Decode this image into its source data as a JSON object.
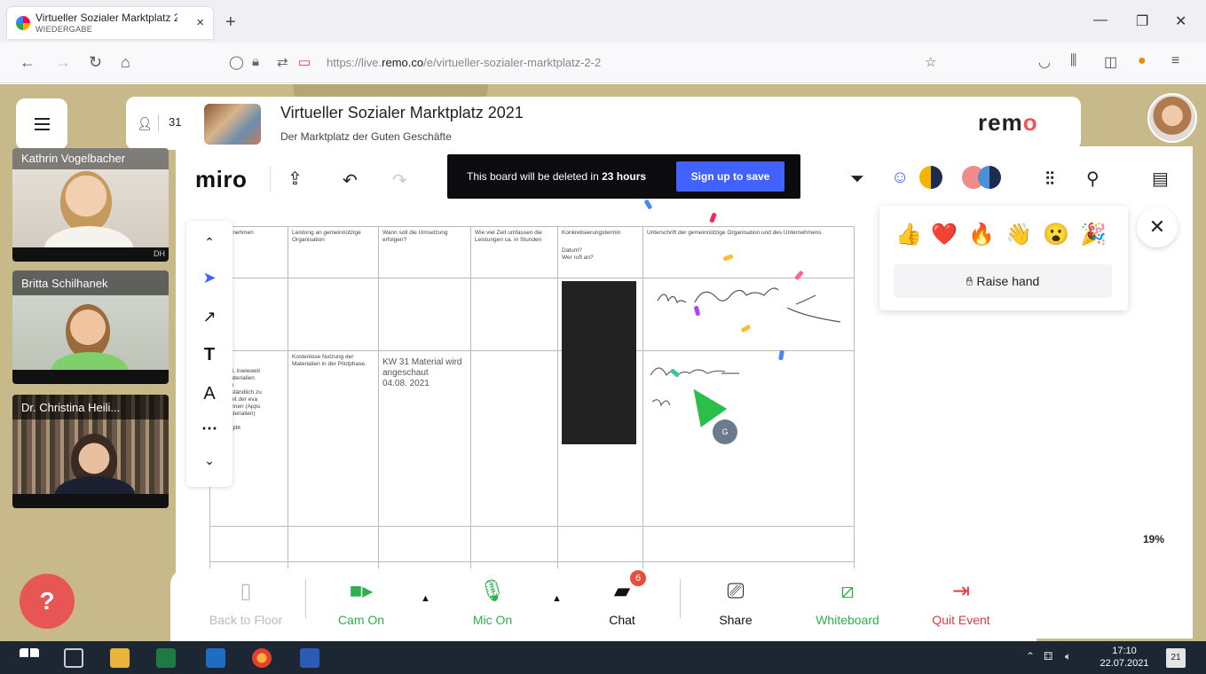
{
  "browser": {
    "tab_title": "Virtueller Sozialer Marktplatz 2",
    "tab_subtitle": "WIEDERGABE",
    "tab_close": "×",
    "newtab": "+",
    "url_prefix": "https://live.",
    "url_domain": "remo.co",
    "url_path": "/e/virtueller-sozialer-marktplatz-2-2"
  },
  "header": {
    "participant_count": "31",
    "event_title": "Virtueller Sozialer Marktplatz 2021",
    "event_subtitle": "Der Marktplatz der Guten Geschäfte",
    "logo_main": "rem",
    "logo_accent": "o"
  },
  "participants": [
    {
      "name": "Kathrin Vogelbacher",
      "tag": "DH"
    },
    {
      "name": "Britta Schilhanek"
    },
    {
      "name": "Dr. Christina Heili..."
    }
  ],
  "miro": {
    "logo": "miro",
    "banner_text_pre": "This board will be deleted in ",
    "banner_hours": "23 hours",
    "signup_label": "Sign up to save",
    "raise_hand_label": "Raise hand",
    "zoom_level": "19%",
    "reactions": [
      "👍",
      "❤️",
      "🔥",
      "👋",
      "😮",
      "🎉"
    ],
    "avatar_initial": "G"
  },
  "table": {
    "headers": [
      "n Unternehmen",
      "Leistung an gemeinnützige Organisation",
      "Wann soll die Umsetzung erfolgen?",
      "Wie viel Zeit umfassen die Leistungen ca. in Stunden",
      "Konkretisierungstermin",
      "Unterschrift der gemeinnützige Organisation und des Unternehmens"
    ],
    "konkret_sub": "Datum?\nWer ruft an?",
    "row2_col1": "ist\n\nag prüft, inwieweit\nungsmaterialien\nhnische\nste verständlich zu\nde Arbeit der eva\nzen können (Apps\nöge Materialien)\n\nst und gibt",
    "row2_col2": "Kostenlose Nutzung der Materialien in der Pilotphase.",
    "row2_col3": "KW 31 Material wird angeschaut\n04.08. 2021"
  },
  "controls": {
    "back_to_floor": "Back to Floor",
    "cam_on": "Cam On",
    "mic_on": "Mic On",
    "chat": "Chat",
    "chat_badge": "6",
    "share": "Share",
    "whiteboard": "Whiteboard",
    "quit_event": "Quit Event"
  },
  "taskbar": {
    "time": "17:10",
    "date": "22.07.2021",
    "notifications": "21"
  },
  "colors": {
    "remo_accent": "#f05454",
    "miro_blue": "#4262ff",
    "cam_green": "#2bb24c",
    "quit_red": "#e63946",
    "app_bg": "#c7b989"
  }
}
